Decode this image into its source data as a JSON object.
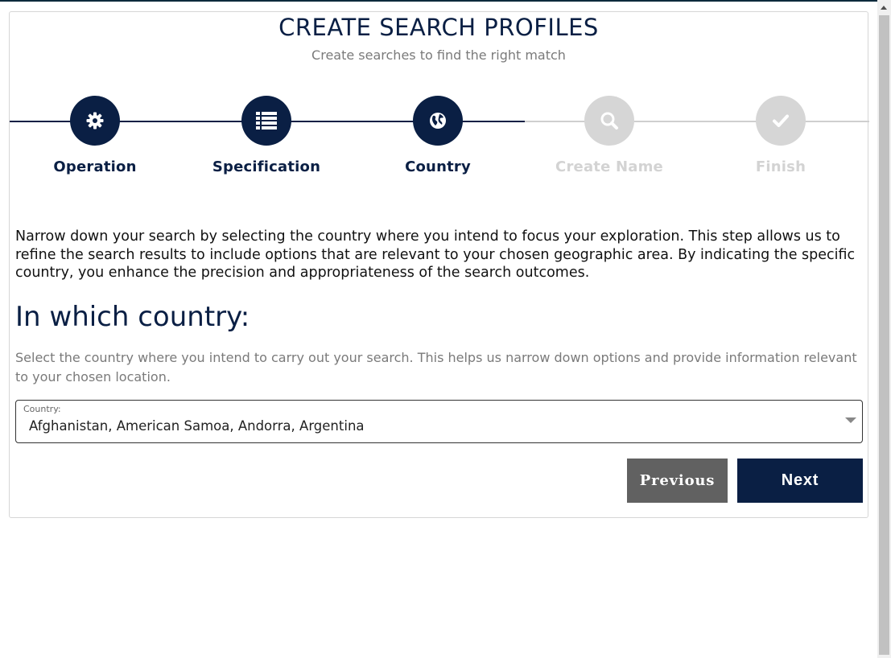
{
  "header": {
    "title": "CREATE SEARCH PROFILES",
    "subtitle": "Create searches to find the right match"
  },
  "steps": [
    {
      "label": "Operation",
      "icon": "gear-icon",
      "state": "completed"
    },
    {
      "label": "Specification",
      "icon": "list-icon",
      "state": "completed"
    },
    {
      "label": "Country",
      "icon": "globe-icon",
      "state": "current"
    },
    {
      "label": "Create Name",
      "icon": "search-icon",
      "state": "pending"
    },
    {
      "label": "Finish",
      "icon": "check-icon",
      "state": "pending"
    }
  ],
  "content": {
    "description": "Narrow down your search by selecting the country where you intend to focus your exploration. This step allows us to refine the search results to include options that are relevant to your chosen geographic area. By indicating the specific country, you enhance the precision and appropriateness of the search outcomes.",
    "question": "In which country:",
    "hint": "Select the country where you intend to carry out your search. This helps us narrow down options and provide information relevant to your chosen location."
  },
  "country_select": {
    "label": "Country:",
    "value": "Afghanistan, American Samoa, Andorra, Argentina"
  },
  "buttons": {
    "previous": "Previous",
    "next": "Next"
  },
  "colors": {
    "primary": "#0a1f44",
    "inactive": "#d6d6d6",
    "previous_button": "#616161",
    "muted_text": "#7a7a7a"
  }
}
